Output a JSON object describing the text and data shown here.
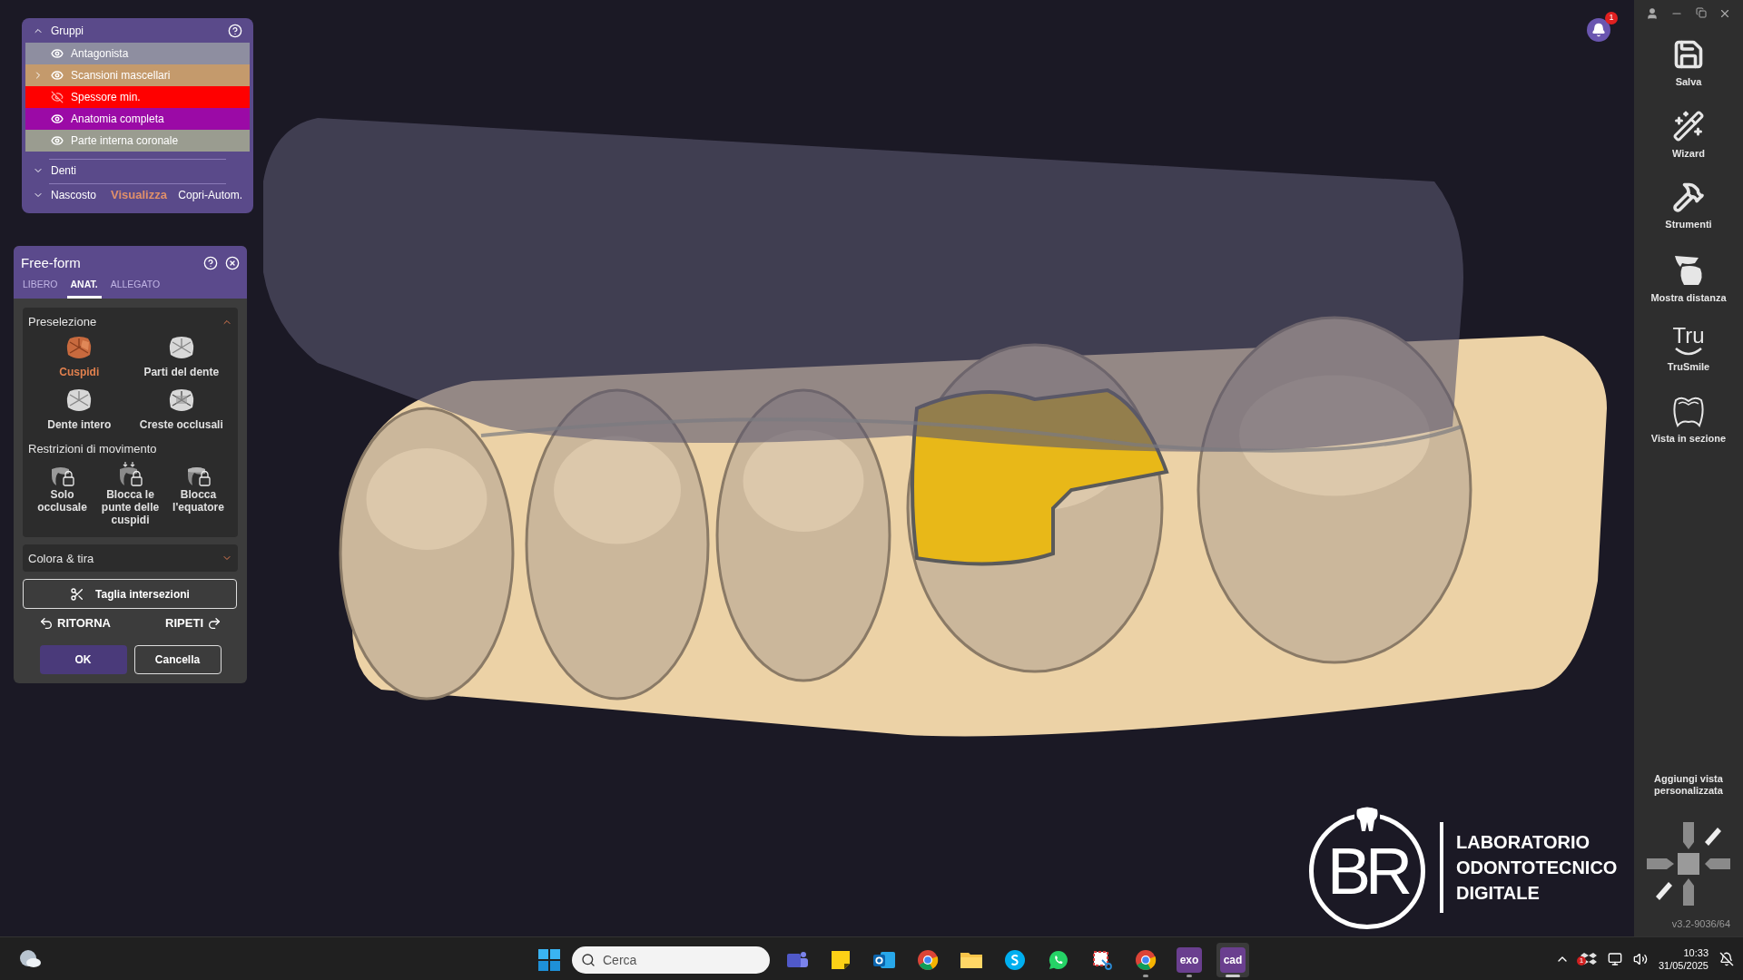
{
  "groups_panel": {
    "title": "Gruppi",
    "expanded": true,
    "items": [
      {
        "label": "Antagonista",
        "color": "#8e8ea0",
        "visible": true,
        "has_children": false
      },
      {
        "label": "Scansioni mascellari",
        "color": "#c49a6c",
        "visible": true,
        "has_children": true
      },
      {
        "label": "Spessore min.",
        "color": "#ff0000",
        "visible": false,
        "has_children": false
      },
      {
        "label": "Anatomia completa",
        "color": "#9b0aa6",
        "visible": true,
        "has_children": false
      },
      {
        "label": "Parte interna coronale",
        "color": "#9a9c90",
        "visible": true,
        "has_children": false
      }
    ],
    "sections": [
      {
        "label": "Denti",
        "expanded": false
      }
    ],
    "hidden": {
      "label": "Nascosto",
      "expanded": false,
      "show": "Visualizza",
      "auto_hide": "Copri-Autom."
    }
  },
  "freeform_panel": {
    "title": "Free-form",
    "tabs": [
      {
        "label": "LIBERO",
        "selected": false
      },
      {
        "label": "ANAT.",
        "selected": true
      },
      {
        "label": "ALLEGATO",
        "selected": false
      }
    ],
    "preselection": {
      "title": "Preselezione",
      "expanded": true,
      "items": [
        {
          "label": "Cuspidi",
          "selected": true,
          "kind": "cusps"
        },
        {
          "label": "Parti del dente",
          "selected": false,
          "kind": "parts"
        },
        {
          "label": "Dente intero",
          "selected": false,
          "kind": "whole"
        },
        {
          "label": "Creste occlusali",
          "selected": false,
          "kind": "ridges"
        }
      ]
    },
    "restrictions": {
      "title": "Restrizioni di movimento",
      "items": [
        {
          "label": "Solo occlusale",
          "kind": "occlusal"
        },
        {
          "label": "Blocca le punte delle cuspidi",
          "kind": "tips"
        },
        {
          "label": "Blocca l'equatore",
          "kind": "equator"
        }
      ]
    },
    "color_pull": {
      "title": "Colora & tira",
      "expanded": false
    },
    "cut_button": "Taglia intersezioni",
    "undo": "RITORNA",
    "redo": "RIPETI",
    "ok": "OK",
    "cancel": "Cancella"
  },
  "notification": {
    "count": "1"
  },
  "sidebar": {
    "tools": [
      {
        "label": "Salva",
        "kind": "save"
      },
      {
        "label": "Wizard",
        "kind": "wizard"
      },
      {
        "label": "Strumenti",
        "kind": "tools"
      },
      {
        "label": "Mostra distanza",
        "kind": "distance"
      },
      {
        "label": "TruSmile",
        "kind": "trusmile",
        "icon_text": "Tru"
      },
      {
        "label": "Vista in sezione",
        "kind": "section"
      }
    ],
    "custom_view": "Aggiungi vista personalizzata",
    "version": "v3.2-9036/64"
  },
  "logo": {
    "monogram": "BR",
    "lines": [
      "LABORATORIO",
      "ODONTOTECNICO",
      "DIGITALE"
    ]
  },
  "taskbar": {
    "search_placeholder": "Cerca",
    "apps": [
      {
        "kind": "teams",
        "running": false,
        "active": false
      },
      {
        "kind": "notes",
        "running": false,
        "active": false
      },
      {
        "kind": "outlook",
        "running": false,
        "active": false
      },
      {
        "kind": "chrome",
        "running": false,
        "active": false
      },
      {
        "kind": "files",
        "running": false,
        "active": false
      },
      {
        "kind": "skype",
        "running": false,
        "active": false
      },
      {
        "kind": "whatsapp",
        "running": false,
        "active": false
      },
      {
        "kind": "snip",
        "running": false,
        "active": false
      },
      {
        "kind": "chrome",
        "running": true,
        "active": false
      },
      {
        "kind": "app",
        "label": "exo",
        "running": true,
        "active": false
      },
      {
        "kind": "app",
        "label": "cad",
        "running": true,
        "active": true
      }
    ],
    "tray_badge": "1",
    "time": "10:33",
    "date": "31/05/2025"
  }
}
